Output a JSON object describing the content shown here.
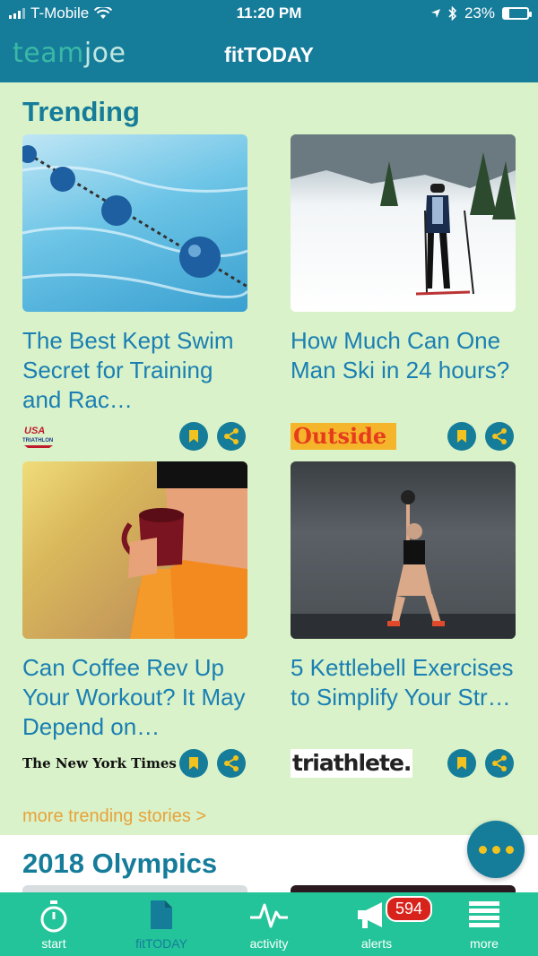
{
  "status": {
    "carrier": "T-Mobile",
    "time": "11:20 PM",
    "battery": "23%"
  },
  "header": {
    "logo_team": "team",
    "logo_joe": "joe",
    "title": "fitTODAY"
  },
  "trending": {
    "title": "Trending",
    "cards": [
      {
        "title": "The Best Kept Swim Secret for Training and Rac…",
        "source": "USA TRIATHLON"
      },
      {
        "title": "How Much Can One Man Ski in 24 hours?",
        "source": "Outside"
      },
      {
        "title": "Can Coffee Rev Up Your Workout? It May Depend on…",
        "source": "The New York Times"
      },
      {
        "title": "5 Kettlebell Exercises to Simplify Your Str…",
        "source": "triathlete."
      }
    ],
    "more_link": "more trending stories >"
  },
  "olympics": {
    "title": "2018 Olympics"
  },
  "tabs": [
    {
      "label": "start",
      "icon": "stopwatch-icon"
    },
    {
      "label": "fitTODAY",
      "icon": "document-icon"
    },
    {
      "label": "activity",
      "icon": "pulse-icon"
    },
    {
      "label": "alerts",
      "icon": "megaphone-icon",
      "badge": "594"
    },
    {
      "label": "more",
      "icon": "menu-icon"
    }
  ],
  "colors": {
    "primary": "#157c9a",
    "background": "#d9f2c9",
    "tabbar": "#24c49a",
    "accent": "#e8a23a",
    "link": "#1a7fb3",
    "badge": "#d8231c"
  }
}
